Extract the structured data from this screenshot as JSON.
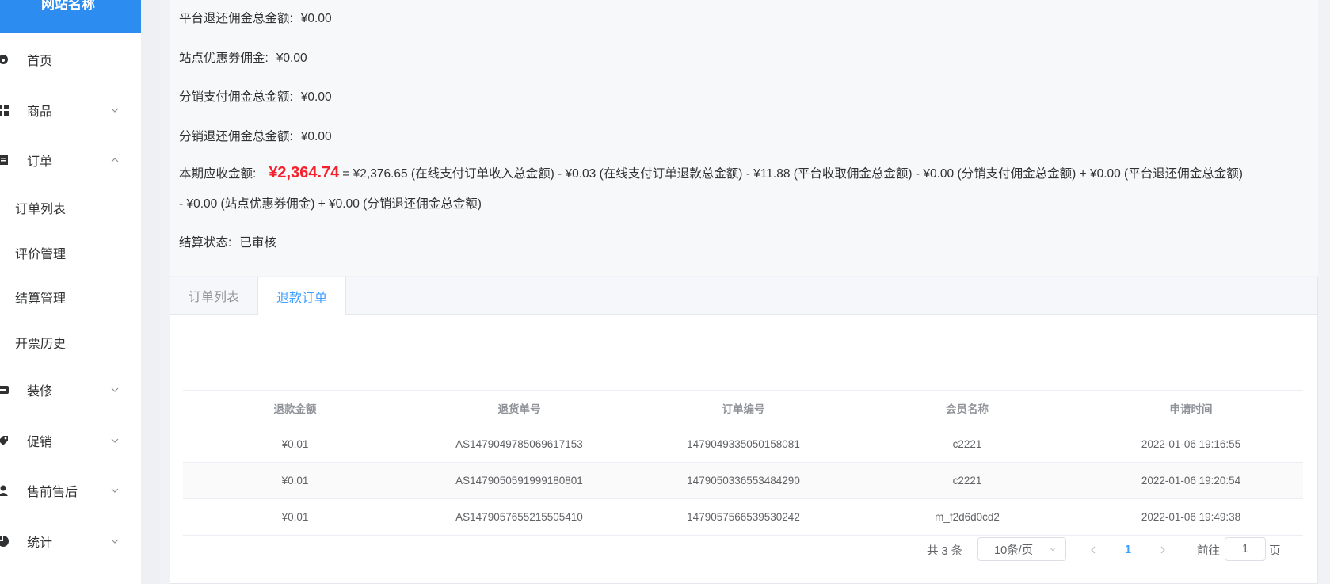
{
  "sidebar": {
    "brand": "网站名称",
    "menu": [
      {
        "label": "首页",
        "icon": "dashboard-icon"
      },
      {
        "label": "商品",
        "icon": "grid-icon"
      },
      {
        "label": "订单",
        "icon": "order-icon"
      },
      {
        "label": "装修",
        "icon": "store-icon"
      },
      {
        "label": "促销",
        "icon": "tag-icon"
      },
      {
        "label": "售前售后",
        "icon": "user-icon"
      },
      {
        "label": "统计",
        "icon": "pie-chart-icon"
      }
    ],
    "order_submenu": [
      "订单列表",
      "评价管理",
      "结算管理",
      "开票历史"
    ]
  },
  "summary": {
    "platform_refund_commission": {
      "label": "平台退还佣金总金额:",
      "value": "¥0.00"
    },
    "site_coupon_commission": {
      "label": "站点优惠券佣金:",
      "value": "¥0.00"
    },
    "distribution_pay_commission": {
      "label": "分销支付佣金总金额:",
      "value": "¥0.00"
    },
    "distribution_refund_commission": {
      "label": "分销退还佣金总金额:",
      "value": "¥0.00"
    },
    "receivable": {
      "label": "本期应收金额:",
      "amount": "¥2,364.74",
      "formula_line1": "= ¥2,376.65 (在线支付订单收入总金额) - ¥0.03 (在线支付订单退款总金额) - ¥11.88 (平台收取佣金总金额) - ¥0.00 (分销支付佣金总金额) + ¥0.00 (平台退还佣金总金额)",
      "formula_line2": "- ¥0.00 (站点优惠券佣金) + ¥0.00 (分销退还佣金总金额)"
    },
    "settlement_status": {
      "label": "结算状态:",
      "value": "已审核"
    }
  },
  "tabs": [
    "订单列表",
    "退款订单"
  ],
  "active_tab": 1,
  "table": {
    "columns": [
      "退款金额",
      "退货单号",
      "订单编号",
      "会员名称",
      "申请时间"
    ],
    "rows": [
      [
        "¥0.01",
        "AS1479049785069617153",
        "1479049335050158081",
        "c2221",
        "2022-01-06 19:16:55"
      ],
      [
        "¥0.01",
        "AS1479050591999180801",
        "1479050336553484290",
        "c2221",
        "2022-01-06 19:20:54"
      ],
      [
        "¥0.01",
        "AS1479057655215505410",
        "1479057566539530242",
        "m_f2d6d0cd2",
        "2022-01-06 19:49:38"
      ]
    ]
  },
  "pagination": {
    "total": "共 3 条",
    "page_size": "10条/页",
    "current_page": "1",
    "goto_label": "前往",
    "goto_value": "1",
    "page_suffix": "页"
  },
  "colors": {
    "brand": "#2d8cf0",
    "accent": "#409eff",
    "amount": "#f5222d"
  }
}
